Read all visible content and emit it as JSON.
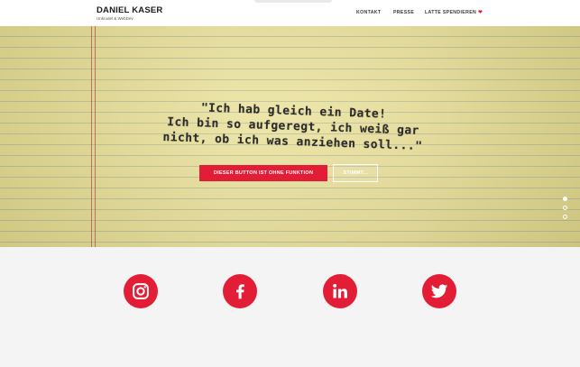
{
  "header": {
    "brand": {
      "title": "DANIEL KASER",
      "subtitle": "Unkrudel & WebDev"
    },
    "nav": [
      {
        "label": "KONTAKT"
      },
      {
        "label": "PRESSE"
      },
      {
        "label": "LATTE SPENDIEREN",
        "icon": "heart-icon"
      }
    ]
  },
  "hero": {
    "quote_lines": [
      "\"Ich hab gleich ein Date!",
      "Ich bin so aufgeregt, ich weiß gar",
      "nicht, ob ich was anziehen soll...\""
    ],
    "primary_button": "DIESER BUTTON IST OHNE FUNKTION",
    "secondary_button": "STIMMT...",
    "slider": {
      "count": 3,
      "active_index": 0
    }
  },
  "social": {
    "links": [
      {
        "icon": "instagram-icon"
      },
      {
        "icon": "facebook-icon"
      },
      {
        "icon": "linkedin-icon"
      },
      {
        "icon": "twitter-icon"
      }
    ]
  },
  "colors": {
    "accent": "#e31d35",
    "paper": "#eae09a",
    "page_background": "#f4f4f4"
  }
}
